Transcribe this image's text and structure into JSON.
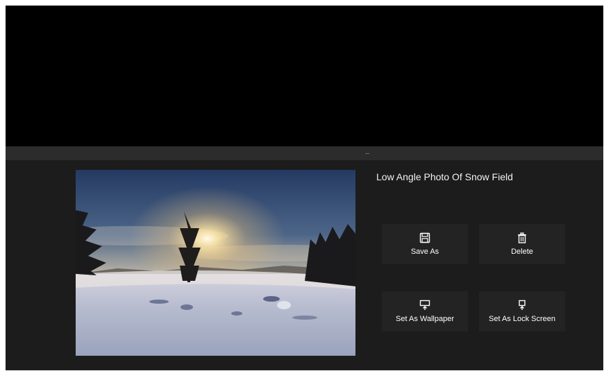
{
  "photo": {
    "title": "Low Angle Photo Of Snow Field"
  },
  "actions": {
    "save_as": {
      "label": "Save As",
      "icon": "save-icon"
    },
    "delete": {
      "label": "Delete",
      "icon": "trash-icon"
    },
    "set_wallpaper": {
      "label": "Set As Wallpaper",
      "icon": "wallpaper-icon"
    },
    "set_lock_screen": {
      "label": "Set As Lock Screen",
      "icon": "lock-screen-icon"
    }
  },
  "colors": {
    "background": "#1c1c1c",
    "header": "#000000",
    "splitter": "#2c2c2c",
    "button": "#232323",
    "text": "#ffffff"
  }
}
